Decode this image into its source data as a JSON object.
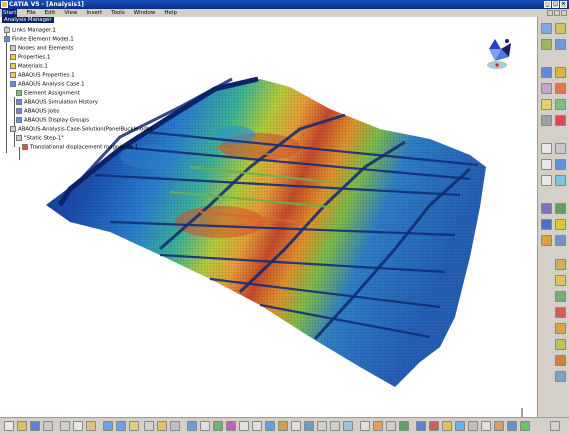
{
  "window": {
    "title": "CATIA V5 - [Analysis1]"
  },
  "menu": [
    "Start",
    "File",
    "Edit",
    "View",
    "Insert",
    "Tools",
    "Window",
    "Help"
  ],
  "tree": {
    "root": "Analysis Manager",
    "nodes": [
      {
        "label": "Links Manager.1",
        "icon": "links-icon",
        "color": "grey"
      },
      {
        "label": "Finite Element Model.1",
        "icon": "fem-icon",
        "color": "blue"
      },
      {
        "label": "Nodes and Elements",
        "icon": "mesh-icon",
        "color": "grey"
      },
      {
        "label": "Properties.1",
        "icon": "properties-icon",
        "color": "yellow"
      },
      {
        "label": "Materials.1",
        "icon": "materials-icon",
        "color": "yellow"
      },
      {
        "label": "ABAQUS Properties.1",
        "icon": "abaqus-props-icon",
        "color": "yellow"
      },
      {
        "label": "ABAQUS Analysis Case.1",
        "icon": "analysis-case-icon",
        "color": "blue"
      },
      {
        "label": "Element Assignment",
        "icon": "assignment-icon",
        "color": "green"
      },
      {
        "label": "ABAQUS Simulation History",
        "icon": "history-icon",
        "color": "blue"
      },
      {
        "label": "ABAQUS Jobs",
        "icon": "jobs-icon",
        "color": "blue"
      },
      {
        "label": "ABAQUS Display Groups",
        "icon": "display-groups-icon",
        "color": "blue"
      },
      {
        "label": "ABAQUS-Analysis-Case-Solution(PanelBuckle.odb)",
        "icon": "solution-icon",
        "color": "grey"
      },
      {
        "label": "\"Static Step-1\"",
        "icon": "step-icon",
        "color": "grey"
      },
      {
        "label": "Translational displacement magnitude.1",
        "icon": "result-icon",
        "color": "red"
      }
    ]
  },
  "colors": {
    "title_bar": "#0a2d86",
    "panel_bg": "#d4d0c8",
    "contour_low": "#1f4fb0",
    "contour_high": "#c0282a"
  }
}
